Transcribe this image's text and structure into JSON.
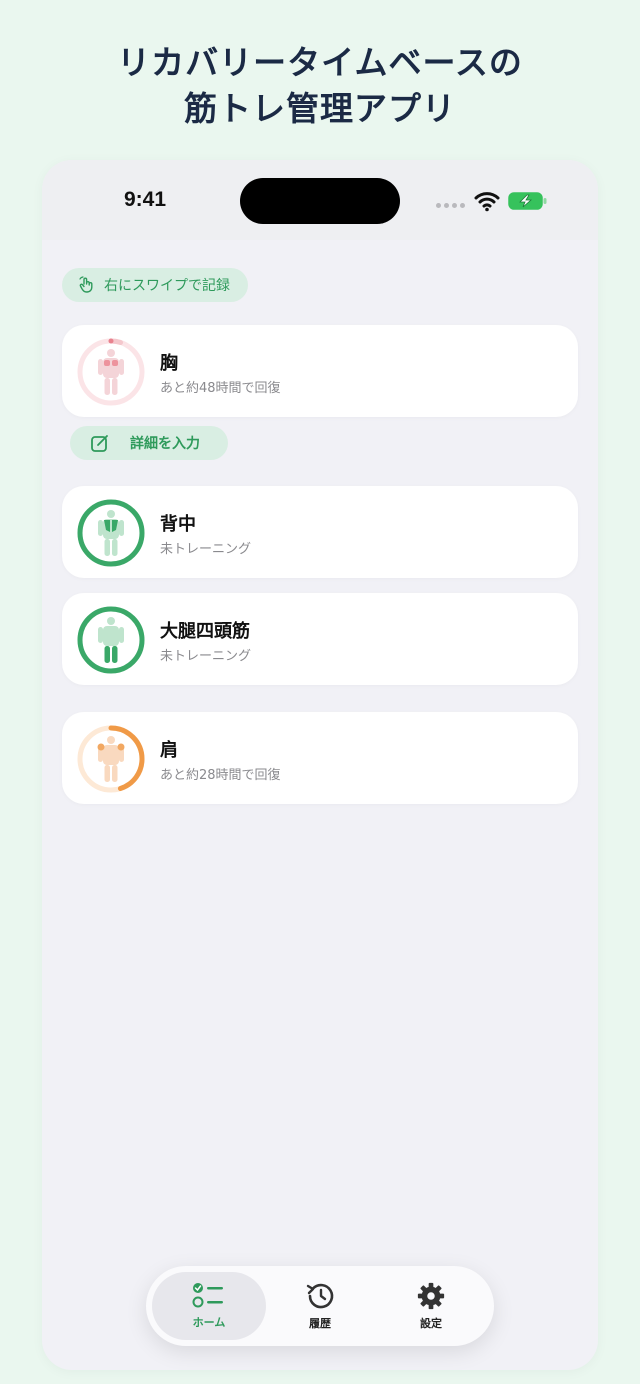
{
  "headline": {
    "line1": "リカバリータイムベースの",
    "line2": "筋トレ管理アプリ"
  },
  "status_bar": {
    "time": "9:41"
  },
  "swipe_hint": {
    "label": "右にスワイプで記録",
    "icon": "hand-swipe-icon"
  },
  "detail_button": {
    "label": "詳細を入力",
    "icon": "edit-icon"
  },
  "muscles": [
    {
      "name": "胸",
      "status": "あと約48時間で回復",
      "ring_color": "#f4c7cc",
      "progress": 0.05
    },
    {
      "name": "背中",
      "status": "未トレーニング",
      "ring_color": "#3aa868",
      "progress": 1.0
    },
    {
      "name": "大腿四頭筋",
      "status": "未トレーニング",
      "ring_color": "#3aa868",
      "progress": 1.0
    },
    {
      "name": "肩",
      "status": "あと約28時間で回復",
      "ring_color": "#f09a47",
      "progress": 0.45
    }
  ],
  "tabs": [
    {
      "label": "ホーム",
      "icon": "checklist-icon",
      "active": true
    },
    {
      "label": "履歴",
      "icon": "history-icon",
      "active": false
    },
    {
      "label": "設定",
      "icon": "gear-icon",
      "active": false
    }
  ],
  "colors": {
    "accent": "#2e9a5b",
    "background": "#eaf7ef"
  }
}
